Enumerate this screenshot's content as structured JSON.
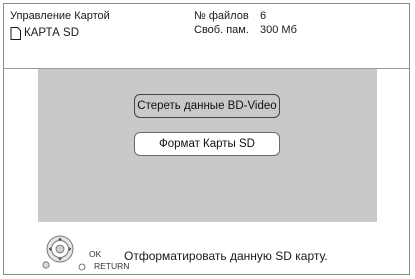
{
  "header": {
    "title": "Управление Картой",
    "card_label": "КАРТА SD",
    "card_icon": "sd-card-icon",
    "stats": [
      {
        "label": "№ файлов",
        "value": "6"
      },
      {
        "label": "Своб. пам.",
        "value": "300 Мб"
      }
    ]
  },
  "menu": {
    "items": [
      {
        "label": "Стереть данные BD-Video",
        "selected": false
      },
      {
        "label": "Формат Карты SD",
        "selected": true
      }
    ]
  },
  "footer": {
    "ok_label": "OK",
    "return_label": "RETURN",
    "hint": "Отформатировать данную SD карту.",
    "remote_icon": "remote-dpad-icon"
  },
  "colors": {
    "panel": "#c9c9c9",
    "border": "#8a8a8a",
    "background": "#ffffff"
  }
}
